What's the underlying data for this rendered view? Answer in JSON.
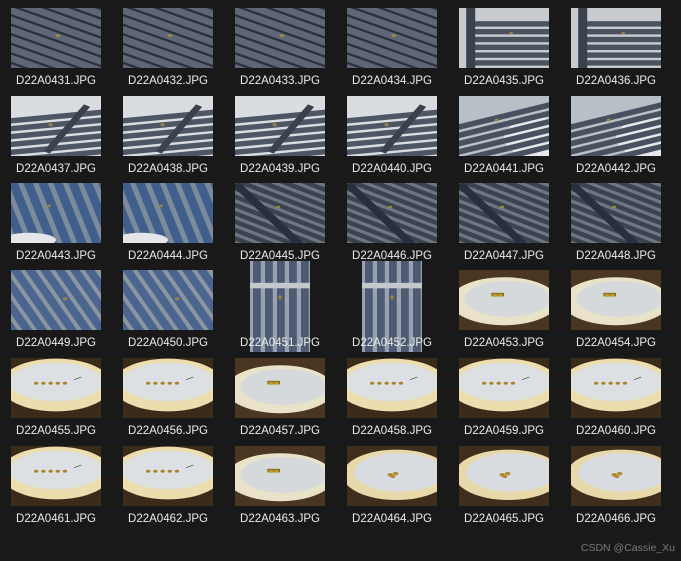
{
  "window": {
    "background": "#191919"
  },
  "files": [
    {
      "name": "D22A0431.JPG",
      "kind": "bench-diag"
    },
    {
      "name": "D22A0432.JPG",
      "kind": "bench-diag"
    },
    {
      "name": "D22A0433.JPG",
      "kind": "bench-diag"
    },
    {
      "name": "D22A0434.JPG",
      "kind": "bench-diag"
    },
    {
      "name": "D22A0435.JPG",
      "kind": "bench-corner"
    },
    {
      "name": "D22A0436.JPG",
      "kind": "bench-corner"
    },
    {
      "name": "D22A0437.JPG",
      "kind": "bench-flat"
    },
    {
      "name": "D22A0438.JPG",
      "kind": "bench-flat"
    },
    {
      "name": "D22A0439.JPG",
      "kind": "bench-flat"
    },
    {
      "name": "D22A0440.JPG",
      "kind": "bench-flat"
    },
    {
      "name": "D22A0441.JPG",
      "kind": "bench-table"
    },
    {
      "name": "D22A0442.JPG",
      "kind": "bench-table"
    },
    {
      "name": "D22A0443.JPG",
      "kind": "bench-blue"
    },
    {
      "name": "D22A0444.JPG",
      "kind": "bench-blue"
    },
    {
      "name": "D22A0445.JPG",
      "kind": "bench-grate"
    },
    {
      "name": "D22A0446.JPG",
      "kind": "bench-grate"
    },
    {
      "name": "D22A0447.JPG",
      "kind": "bench-grate"
    },
    {
      "name": "D22A0448.JPG",
      "kind": "bench-grate"
    },
    {
      "name": "D22A0449.JPG",
      "kind": "bench-blue2"
    },
    {
      "name": "D22A0450.JPG",
      "kind": "bench-blue2"
    },
    {
      "name": "D22A0451.JPG",
      "kind": "portrait"
    },
    {
      "name": "D22A0452.JPG",
      "kind": "portrait"
    },
    {
      "name": "D22A0453.JPG",
      "kind": "plate"
    },
    {
      "name": "D22A0454.JPG",
      "kind": "plate"
    },
    {
      "name": "D22A0455.JPG",
      "kind": "plate-bright"
    },
    {
      "name": "D22A0456.JPG",
      "kind": "plate-bright"
    },
    {
      "name": "D22A0457.JPG",
      "kind": "plate"
    },
    {
      "name": "D22A0458.JPG",
      "kind": "plate-bright"
    },
    {
      "name": "D22A0459.JPG",
      "kind": "plate-bright"
    },
    {
      "name": "D22A0460.JPG",
      "kind": "plate-bright"
    },
    {
      "name": "D22A0461.JPG",
      "kind": "plate-bright"
    },
    {
      "name": "D22A0462.JPG",
      "kind": "plate-bright"
    },
    {
      "name": "D22A0463.JPG",
      "kind": "plate"
    },
    {
      "name": "D22A0464.JPG",
      "kind": "plate-right"
    },
    {
      "name": "D22A0465.JPG",
      "kind": "plate-right"
    },
    {
      "name": "D22A0466.JPG",
      "kind": "plate-right"
    }
  ],
  "watermark": "CSDN @Cassie_Xu"
}
